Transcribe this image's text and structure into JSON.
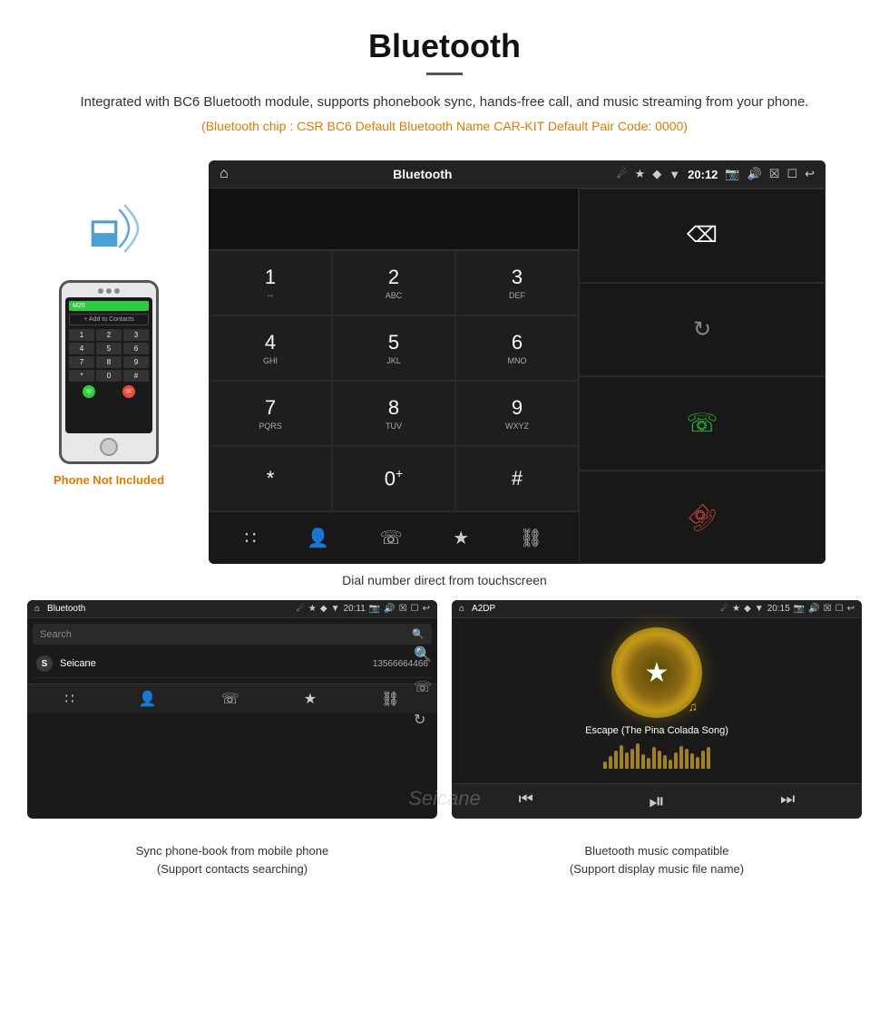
{
  "header": {
    "title": "Bluetooth",
    "description": "Integrated with BC6 Bluetooth module, supports phonebook sync, hands-free call, and music streaming from your phone.",
    "specs": "(Bluetooth chip : CSR BC6    Default Bluetooth Name CAR-KIT    Default Pair Code: 0000)"
  },
  "phone_not_included": "Phone Not Included",
  "car_dialpad": {
    "status_bar": {
      "title": "Bluetooth",
      "time": "20:12"
    },
    "keys": [
      {
        "num": "1",
        "letters": "⌓"
      },
      {
        "num": "2",
        "letters": "ABC"
      },
      {
        "num": "3",
        "letters": "DEF"
      },
      {
        "num": "4",
        "letters": "GHI"
      },
      {
        "num": "5",
        "letters": "JKL"
      },
      {
        "num": "6",
        "letters": "MNO"
      },
      {
        "num": "7",
        "letters": "PQRS"
      },
      {
        "num": "8",
        "letters": "TUV"
      },
      {
        "num": "9",
        "letters": "WXYZ"
      },
      {
        "num": "*",
        "letters": ""
      },
      {
        "num": "0",
        "letters": "+"
      },
      {
        "num": "#",
        "letters": ""
      }
    ],
    "caption": "Dial number direct from touchscreen"
  },
  "phonebook_screen": {
    "status_bar": {
      "title": "Bluetooth",
      "time": "20:11"
    },
    "search_placeholder": "Search",
    "contacts": [
      {
        "letter": "S",
        "name": "Seicane",
        "number": "13566664466"
      }
    ]
  },
  "music_screen": {
    "status_bar": {
      "title": "A2DP",
      "time": "20:15"
    },
    "song_title": "Escape (The Pina Colada Song)"
  },
  "bottom_captions": {
    "phonebook": "Sync phone-book from mobile phone\n(Support contacts searching)",
    "music": "Bluetooth music compatible\n(Support display music file name)"
  },
  "watermark": "Seicane",
  "spectrum_heights": [
    8,
    14,
    20,
    26,
    18,
    22,
    28,
    16,
    12,
    24,
    20,
    15,
    10,
    18,
    25,
    22,
    17,
    13,
    20,
    24
  ]
}
